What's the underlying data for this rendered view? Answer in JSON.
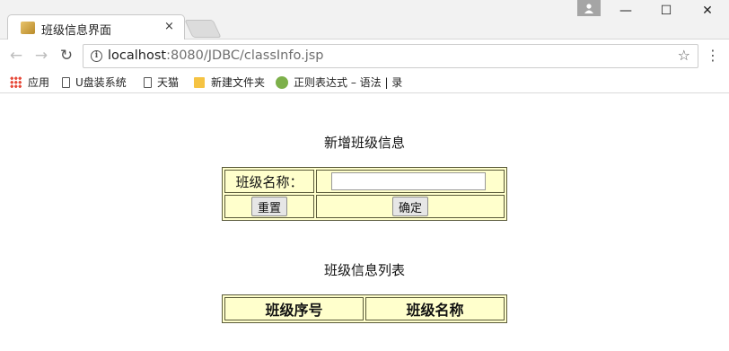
{
  "browser": {
    "tab_title": "班级信息界面",
    "tab_close": "×",
    "profile_icon": "person-icon",
    "window_controls": {
      "minimize": "—",
      "maximize": "☐",
      "close": "✕"
    },
    "url_host": "localhost",
    "url_rest": ":8080/JDBC/classInfo.jsp",
    "bookmarks": [
      {
        "label": "应用",
        "icon": "apps-icon"
      },
      {
        "label": "U盘装系统",
        "icon": "page-icon"
      },
      {
        "label": "天猫",
        "icon": "page-icon"
      },
      {
        "label": "新建文件夹",
        "icon": "folder-icon"
      },
      {
        "label": "正则表达式 – 语法 | 录",
        "icon": "regex-icon"
      }
    ]
  },
  "page": {
    "add_title": "新增班级信息",
    "class_name_label": "班级名称：",
    "class_name_value": "",
    "reset_button": "重置",
    "confirm_button": "确定",
    "list_title": "班级信息列表",
    "list_headers": [
      "班级序号",
      "班级名称"
    ]
  }
}
